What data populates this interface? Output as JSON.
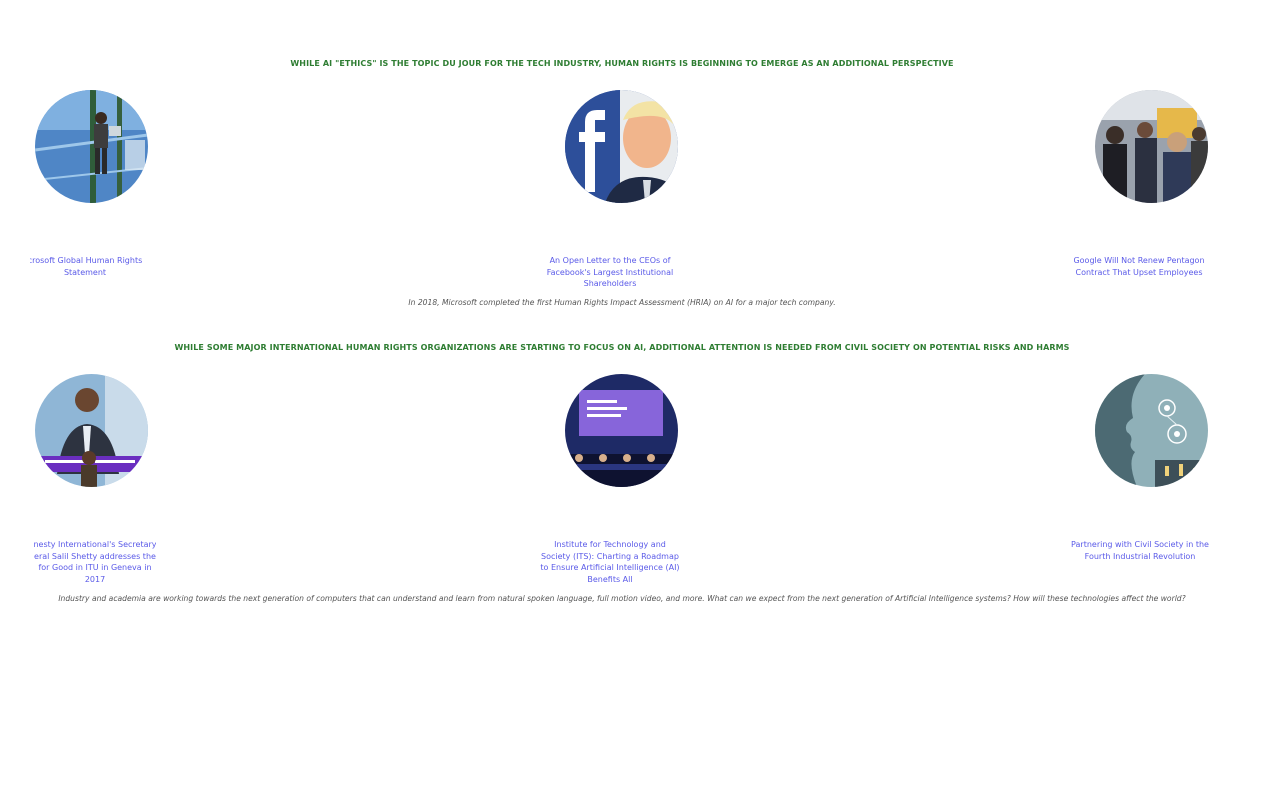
{
  "section1": {
    "heading": "WHILE AI \"ETHICS\" IS THE TOPIC DU JOUR FOR THE TECH INDUSTRY, HUMAN RIGHTS IS BEGINNING TO EMERGE AS AN ADDITIONAL PERSPECTIVE",
    "cards": [
      {
        "caption": "crosoft Global Human Rights Statement"
      },
      {
        "caption": "An Open Letter to the CEOs of Facebook's Largest Institutional Shareholders"
      },
      {
        "caption": "Google Will Not Renew Pentagon Contract That Upset Employees"
      }
    ],
    "description": "In 2018, Microsoft completed the first Human Rights Impact Assessment (HRIA) on AI for a major tech company."
  },
  "section2": {
    "heading": "WHILE SOME MAJOR INTERNATIONAL HUMAN RIGHTS ORGANIZATIONS ARE STARTING TO FOCUS ON AI, ADDITIONAL ATTENTION IS NEEDED FROM CIVIL SOCIETY ON POTENTIAL RISKS AND HARMS",
    "cards": [
      {
        "caption_lines": [
          "nesty International's Secretary",
          "eral Salil Shetty addresses the",
          "for Good in ITU in Geneva in",
          "2017"
        ]
      },
      {
        "caption": "Institute for Technology and Society (ITS): Charting a Roadmap to Ensure Artificial Intelligence (AI) Benefits All"
      },
      {
        "caption": "Partnering with Civil Society in the Fourth Industrial Revolution"
      }
    ],
    "description": "Industry and academia are working towards the next generation of computers that can understand and learn from natural spoken language, full motion video, and more. What can we expect from the next generation of Artificial Intelligence systems? How will these technologies affect the world?"
  },
  "colors": {
    "heading": "#2e7d32",
    "link": "#5a5ae8",
    "description": "#555555"
  }
}
